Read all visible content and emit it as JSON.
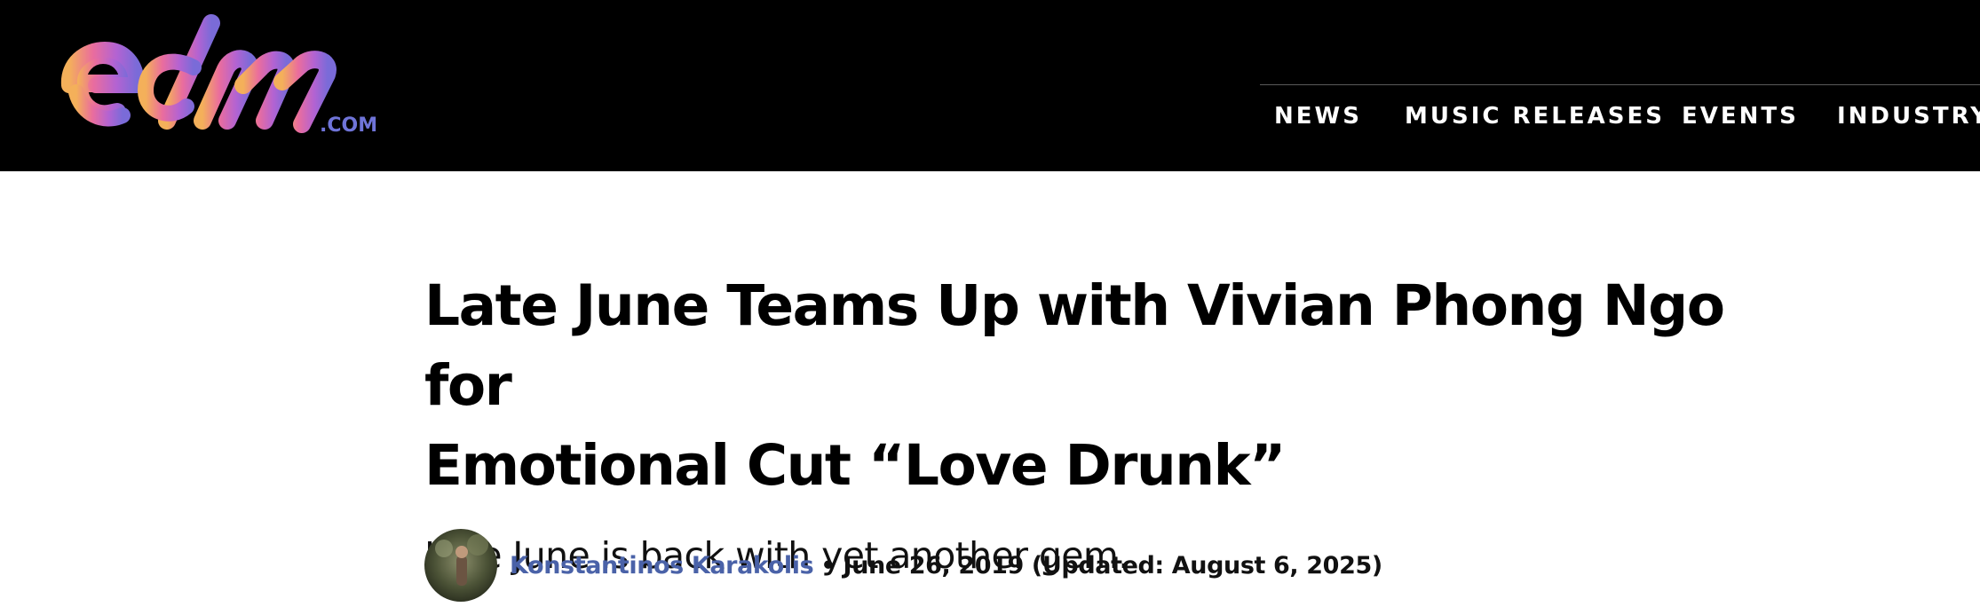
{
  "site": {
    "logo_text": "edm",
    "logo_suffix": ".COM",
    "brand_gradient": [
      "#f2a05a",
      "#e66aa8",
      "#b565d4",
      "#6f6fd6"
    ]
  },
  "nav": {
    "items": [
      {
        "label": "NEWS"
      },
      {
        "label": "MUSIC RELEASES"
      },
      {
        "label": "EVENTS"
      },
      {
        "label": "INDUSTRY"
      }
    ]
  },
  "article": {
    "title_line1": "Late June Teams Up with Vivian Phong Ngo for",
    "title_line2": "Emotional Cut “Love Drunk”",
    "subtitle": "Late June is back with yet another gem.",
    "author": "Konstantinos Karakolis",
    "separator": "•",
    "date": "June 26, 2019 (Updated: August 6, 2025)"
  },
  "colors": {
    "header_bg": "#000000",
    "author_link": "#4a62a8"
  }
}
